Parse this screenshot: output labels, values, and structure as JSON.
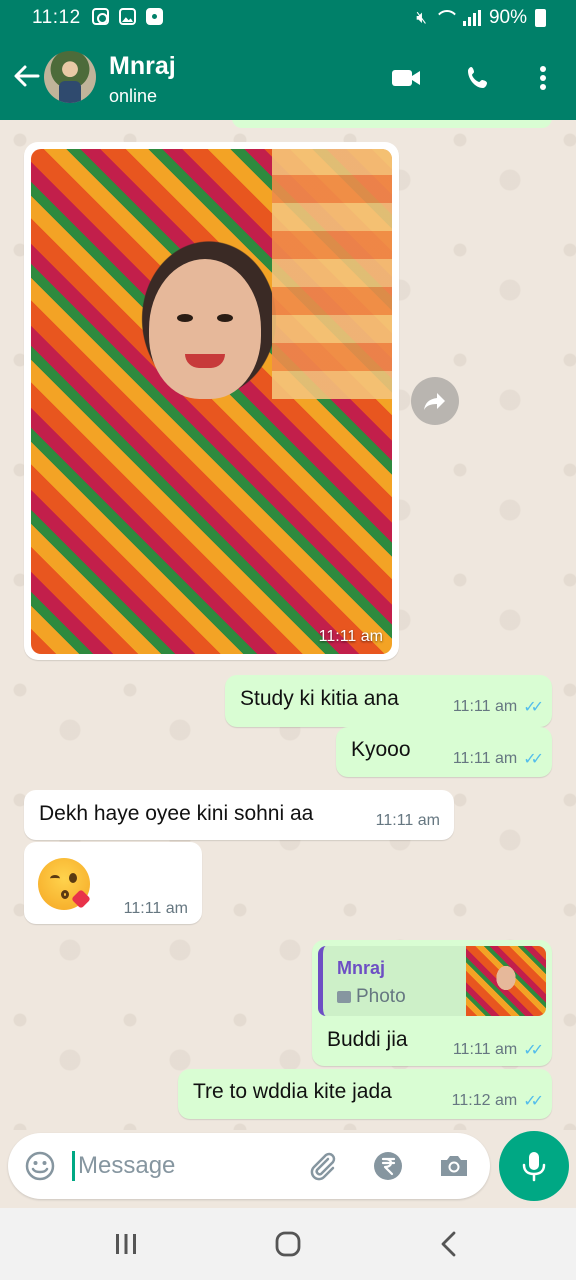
{
  "status_bar": {
    "time": "11:12",
    "battery": "90%",
    "left_icons": [
      "instagram-icon",
      "gallery-icon",
      "app-notification-icon"
    ],
    "right_icons": [
      "mute-icon",
      "wifi-icon",
      "signal-icon",
      "battery-icon"
    ]
  },
  "header": {
    "contact_name": "Mnraj",
    "contact_status": "online",
    "icons": [
      "back-arrow-icon",
      "video-call-icon",
      "voice-call-icon",
      "more-options-icon"
    ]
  },
  "colors": {
    "header": "#008069",
    "outgoing_bubble": "#d9fdd3",
    "incoming_bubble": "#ffffff",
    "accent": "#00a884",
    "read_ticks": "#53bdeb",
    "reply_author": "#6d4fc4"
  },
  "messages": [
    {
      "type": "image",
      "direction": "in",
      "time": "11:11 am"
    },
    {
      "type": "text",
      "direction": "out",
      "text": "Study ki kitia ana",
      "time": "11:11 am",
      "status": "read"
    },
    {
      "type": "text",
      "direction": "out",
      "text": "Kyooo",
      "time": "11:11 am",
      "status": "read"
    },
    {
      "type": "text",
      "direction": "in",
      "text": "Dekh haye oyee kini sohni aa",
      "time": "11:11 am"
    },
    {
      "type": "emoji",
      "direction": "in",
      "emoji": "kissing-face-heart-emoji",
      "time": "11:11 am"
    },
    {
      "type": "reply",
      "direction": "out",
      "quoted_author": "Mnraj",
      "quoted_type": "Photo",
      "text": "Buddi jia",
      "time": "11:11 am",
      "status": "read"
    },
    {
      "type": "text",
      "direction": "out",
      "text": "Tre to wddia kite jada",
      "time": "11:12 am",
      "status": "read"
    }
  ],
  "input": {
    "placeholder": "Message",
    "icons": [
      "emoji-icon",
      "attach-icon",
      "rupee-payment-icon",
      "camera-icon",
      "mic-icon"
    ]
  },
  "nav": {
    "icons": [
      "recent-apps-icon",
      "home-icon",
      "back-icon"
    ]
  }
}
